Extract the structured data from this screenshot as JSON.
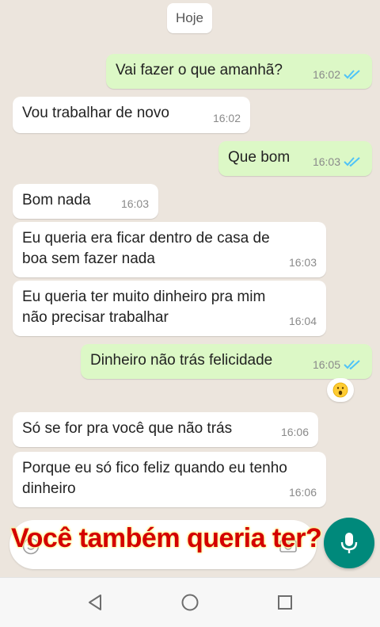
{
  "chat": {
    "date_label": "Hoje",
    "messages": [
      {
        "direction": "out",
        "text": "Vai fazer o que amanhã?",
        "time": "16:02",
        "status": "read"
      },
      {
        "direction": "in",
        "text": "Vou trabalhar de novo",
        "time": "16:02"
      },
      {
        "direction": "out",
        "text": "Que bom",
        "time": "16:03",
        "status": "read"
      },
      {
        "direction": "in",
        "text": "Bom nada",
        "time": "16:03"
      },
      {
        "direction": "in",
        "text": "Eu queria era ficar dentro de casa de\nboa sem fazer nada",
        "time": "16:03"
      },
      {
        "direction": "in",
        "text": "Eu queria ter muito dinheiro pra mim\nnão precisar trabalhar",
        "time": "16:04"
      },
      {
        "direction": "out",
        "text": "Dinheiro não trás felicidade",
        "time": "16:05",
        "status": "read",
        "reaction": "surprised-face-emoji"
      },
      {
        "direction": "in",
        "text": "Só se for pra você que não trás",
        "time": "16:06"
      },
      {
        "direction": "in",
        "text": "Porque eu só fico feliz quando eu tenho\ndinheiro",
        "time": "16:06"
      }
    ]
  },
  "composer": {
    "placeholder": "",
    "overlay_caption": "Você também queria ter?"
  },
  "colors": {
    "background": "#ece5dd",
    "outgoing_bubble": "#dcf8c6",
    "incoming_bubble": "#ffffff",
    "read_ticks": "#4fc3f7",
    "mic_button": "#00897b",
    "caption": "#d40000"
  },
  "icons": {
    "emoji_button": "emoji-icon",
    "camera_button": "camera-icon",
    "mic_button": "microphone-icon",
    "nav_back": "back-triangle-icon",
    "nav_home": "home-circle-icon",
    "nav_recents": "recents-square-icon"
  }
}
